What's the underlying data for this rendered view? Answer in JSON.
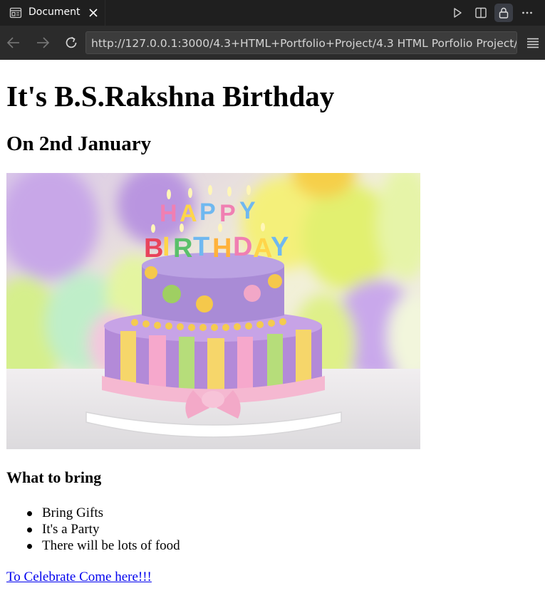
{
  "editor": {
    "tab": {
      "title": "Document",
      "icon": "preview-icon"
    }
  },
  "browser": {
    "url": "http://127.0.0.1:3000/4.3+HTML+Portfolio+Project/4.3 HTML Porfolio Project/pub"
  },
  "page": {
    "heading": "It's B.S.Rakshna Birthday",
    "subheading": "On 2nd January",
    "image": {
      "cake_topper": [
        "HAPPY",
        "BIRTHDAY"
      ]
    },
    "section_heading": "What to bring",
    "bring_list": [
      "Bring Gifts",
      "It's a Party",
      "There will be lots of food"
    ],
    "link_text": "To Celebrate Come here!!!"
  },
  "colors": {
    "tabbar_bg": "#1f1f1f",
    "toolbar_bg": "#2b2b2b",
    "urlbar_bg": "#3c3c3c",
    "link": "#0000ee"
  }
}
